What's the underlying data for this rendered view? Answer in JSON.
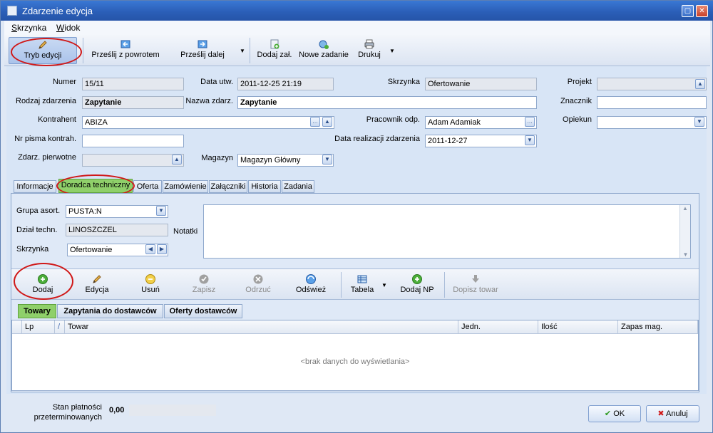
{
  "window": {
    "title": "Zdarzenie edycja"
  },
  "menu": {
    "items": [
      {
        "label": "Skrzynka"
      },
      {
        "label": "Widok"
      }
    ]
  },
  "toolbar": {
    "edit_mode": "Tryb edycji",
    "send_back": "Prześlij z powrotem",
    "send_forward": "Prześlij dalej",
    "add_attachment": "Dodaj zał.",
    "new_task": "Nowe zadanie",
    "print": "Drukuj"
  },
  "form": {
    "numer_label": "Numer",
    "numer": "15/11",
    "data_utw_label": "Data utw.",
    "data_utw": "2011-12-25 21:19",
    "skrzynka_label": "Skrzynka",
    "skrzynka": "Ofertowanie",
    "projekt_label": "Projekt",
    "projekt": "",
    "rodzaj_label": "Rodzaj zdarzenia",
    "rodzaj": "Zapytanie",
    "nazwa_label": "Nazwa zdarz.",
    "nazwa": "Zapytanie",
    "znacznik_label": "Znacznik",
    "znacznik": "",
    "kontrahent_label": "Kontrahent",
    "kontrahent": "ABIZA",
    "pracownik_label": "Pracownik odp.",
    "pracownik": "Adam Adamiak",
    "opiekun_label": "Opiekun",
    "opiekun": "",
    "nr_pisma_label": "Nr pisma kontrah.",
    "nr_pisma": "",
    "data_real_label": "Data realizacji zdarzenia",
    "data_real": "2011-12-27",
    "zdarz_pierw_label": "Zdarz. pierwotne",
    "zdarz_pierw": "",
    "magazyn_label": "Magazyn",
    "magazyn": "Magazyn Główny"
  },
  "tabs": [
    {
      "label": "Informacje"
    },
    {
      "label": "Doradca techniczny"
    },
    {
      "label": "Oferta"
    },
    {
      "label": "Zamówienie"
    },
    {
      "label": "Załączniki"
    },
    {
      "label": "Historia"
    },
    {
      "label": "Zadania"
    }
  ],
  "panel": {
    "grupa_label": "Grupa asort.",
    "grupa": "PUSTA:N",
    "dzial_label": "Dział techn.",
    "dzial": "LINOSZCZEL",
    "skrzynka_label": "Skrzynka",
    "skrzynka": "Ofertowanie",
    "notatki_label": "Notatki",
    "notatki": ""
  },
  "subtoolbar": {
    "add": "Dodaj",
    "edit": "Edycja",
    "delete": "Usuń",
    "save": "Zapisz",
    "discard": "Odrzuć",
    "refresh": "Odśwież",
    "table": "Tabela",
    "add_np": "Dodaj NP",
    "add_item": "Dopisz towar"
  },
  "inner_tabs": [
    {
      "label": "Towary"
    },
    {
      "label": "Zapytania do dostawców"
    },
    {
      "label": "Oferty dostawców"
    }
  ],
  "grid": {
    "columns": [
      {
        "label": "Lp"
      },
      {
        "label": "/"
      },
      {
        "label": "Towar"
      },
      {
        "label": "Jedn."
      },
      {
        "label": "Ilość"
      },
      {
        "label": "Zapas mag."
      }
    ],
    "empty_text": "<brak danych do wyświetlania>"
  },
  "bottom": {
    "stan_label_1": "Stan płatności",
    "stan_label_2": "przeterminowanych",
    "stan_value": "0,00",
    "ok": "OK",
    "cancel": "Anuluj"
  },
  "colors": {
    "accent": "#2b5fb8",
    "selected_tab": "#8fd06a",
    "highlight": "#d01818"
  }
}
